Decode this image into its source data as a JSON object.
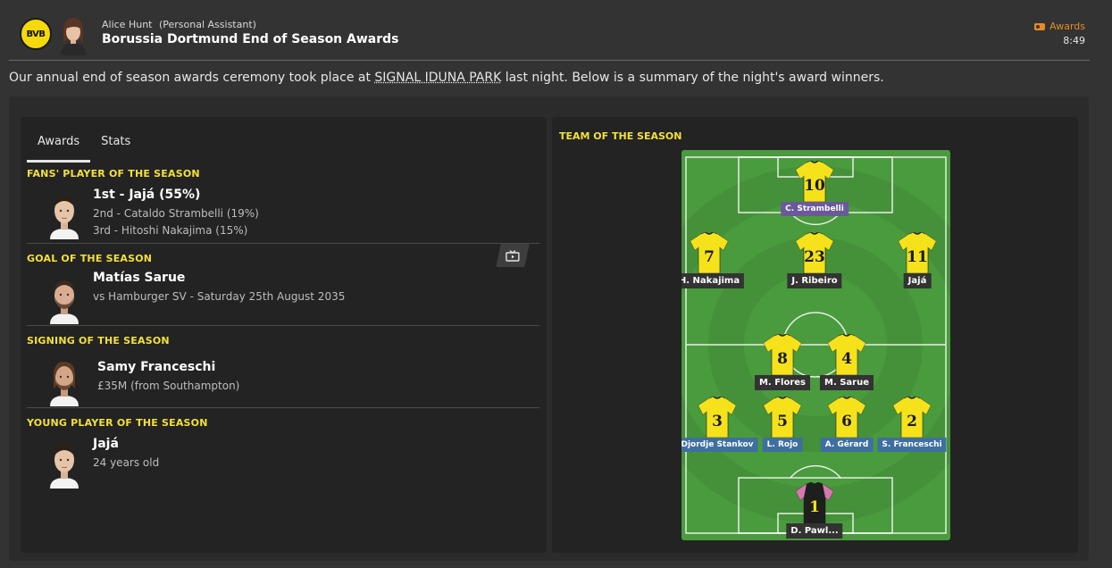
{
  "header": {
    "club_badge_text": "BVB",
    "sender_name": "Alice Hunt",
    "sender_role": "(Personal Assistant)",
    "title": "Borussia Dortmund End of Season Awards",
    "tag_label": "Awards",
    "time": "8:49"
  },
  "intro": {
    "before": "Our annual end of season awards ceremony took place at ",
    "stadium": "SIGNAL IDUNA PARK",
    "after": " last night. Below is a summary of the night's award winners."
  },
  "tabs": [
    {
      "label": "Awards",
      "active": true
    },
    {
      "label": "Stats",
      "active": false
    }
  ],
  "awards": {
    "fans": {
      "title": "FANS' PLAYER OF THE SEASON",
      "first": "1st - Jajá (55%)",
      "second": "2nd - Cataldo Strambelli (19%)",
      "third": "3rd - Hitoshi Nakajima (15%)"
    },
    "goal": {
      "title": "GOAL OF THE SEASON",
      "player": "Matías Sarue",
      "detail": "vs Hamburger SV - Saturday 25th August 2035",
      "icon": "tv-icon"
    },
    "signing": {
      "title": "SIGNING OF THE SEASON",
      "player": "Samy Franceschi",
      "detail": "£35M (from Southampton)"
    },
    "young": {
      "title": "YOUNG PLAYER OF THE SEASON",
      "player": "Jajá",
      "detail": "24 years old"
    }
  },
  "team_of_season": {
    "title": "TEAM OF THE SEASON",
    "players": [
      {
        "number": "10",
        "name": "C. Strambelli",
        "label_style": "purple"
      },
      {
        "number": "7",
        "name": "H. Nakajima",
        "label_style": "dark"
      },
      {
        "number": "23",
        "name": "J. Ribeiro",
        "label_style": "dark"
      },
      {
        "number": "11",
        "name": "Jajá",
        "label_style": "dark"
      },
      {
        "number": "8",
        "name": "M. Flores",
        "label_style": "dark"
      },
      {
        "number": "4",
        "name": "M. Sarue",
        "label_style": "dark"
      },
      {
        "number": "3",
        "name": "Djordje Stankov",
        "label_style": "blue"
      },
      {
        "number": "5",
        "name": "L. Rojo",
        "label_style": "blue"
      },
      {
        "number": "6",
        "name": "A. Gérard",
        "label_style": "blue"
      },
      {
        "number": "2",
        "name": "S. Franceschi",
        "label_style": "blue"
      },
      {
        "number": "1",
        "name": "D. Pawl...",
        "label_style": "dark"
      }
    ]
  },
  "colors": {
    "background": "#333333",
    "card": "#232323",
    "accent_yellow": "#f3e03b",
    "tag_orange": "#e38b2c",
    "pitch_green": "#4a9a3e",
    "kit_yellow": "#f5e21b",
    "gk_kit": "#d678b0"
  }
}
